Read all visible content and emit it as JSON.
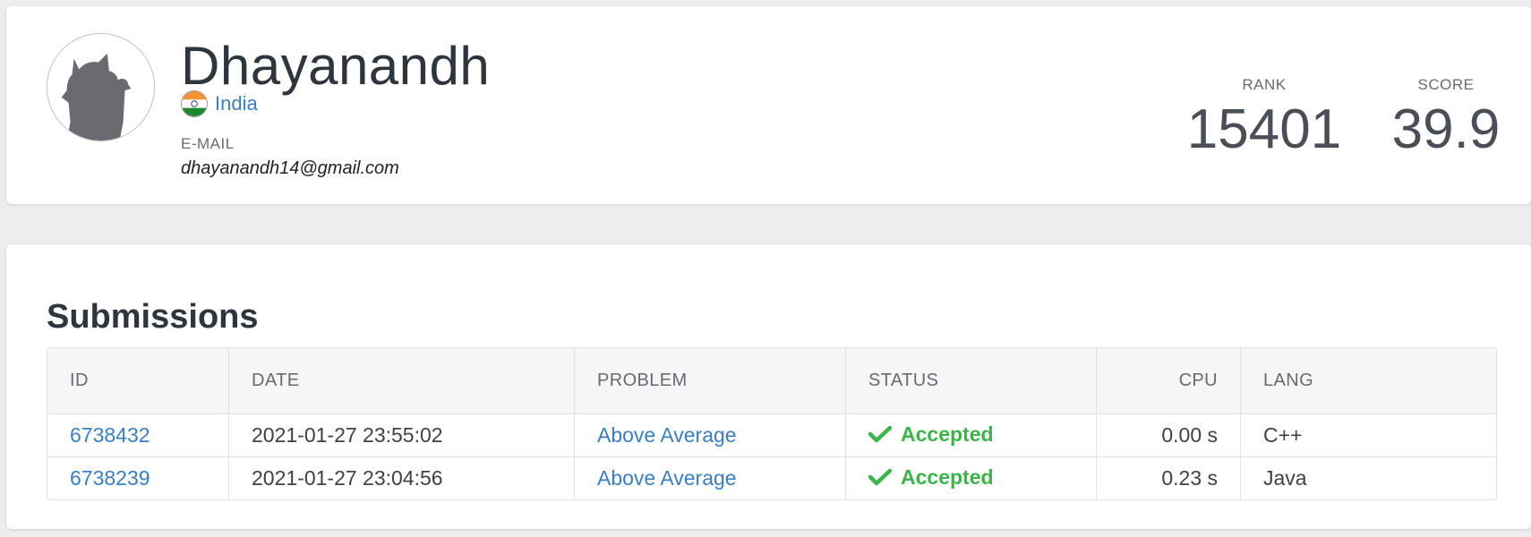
{
  "profile": {
    "name": "Dhayanandh",
    "country": "India",
    "email_label": "E-MAIL",
    "email": "dhayanandh14@gmail.com",
    "rank_label": "RANK",
    "rank": "15401",
    "score_label": "SCORE",
    "score": "39.9"
  },
  "submissions": {
    "title": "Submissions",
    "columns": [
      "ID",
      "DATE",
      "PROBLEM",
      "STATUS",
      "CPU",
      "LANG"
    ],
    "rows": [
      {
        "id": "6738432",
        "date": "2021-01-27 23:55:02",
        "problem": "Above Average",
        "status": "Accepted",
        "cpu": "0.00 s",
        "lang": "C++"
      },
      {
        "id": "6738239",
        "date": "2021-01-27 23:04:56",
        "problem": "Above Average",
        "status": "Accepted",
        "cpu": "0.23 s",
        "lang": "Java"
      }
    ]
  },
  "icons": {
    "avatar": "cat-silhouette-icon",
    "flag": "india-flag-icon",
    "status": "checkmark-icon"
  },
  "colors": {
    "link": "#3a7fc1",
    "accepted": "#3bb54a"
  }
}
